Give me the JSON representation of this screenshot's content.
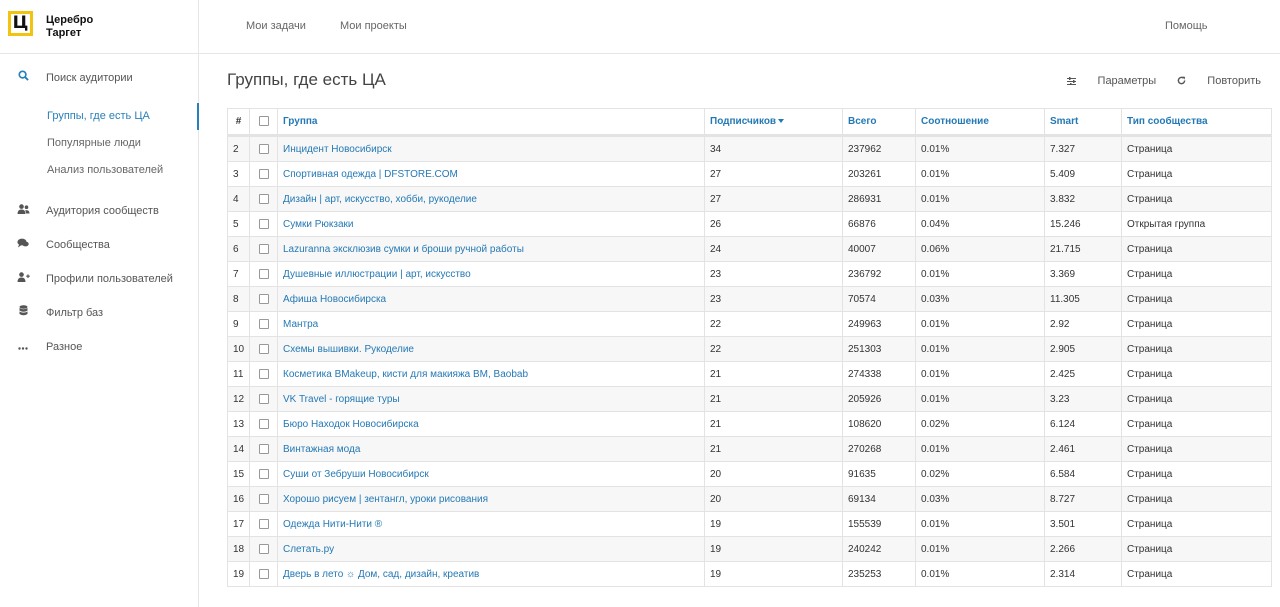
{
  "app": {
    "logo_mark": "Ц",
    "logo_line1": "Церебро",
    "logo_line2": "Таргет"
  },
  "topnav": {
    "tasks": "Мои задачи",
    "projects": "Мои проекты",
    "help": "Помощь"
  },
  "sidebar": {
    "search_audience": "Поиск аудитории",
    "sub": [
      "Группы, где есть ЦА",
      "Популярные люди",
      "Анализ пользователей"
    ],
    "items": [
      "Аудитория сообществ",
      "Сообщества",
      "Профили пользователей",
      "Фильтр баз",
      "Разное"
    ]
  },
  "page": {
    "title": "Группы, где есть ЦА",
    "params": "Параметры",
    "repeat": "Повторить"
  },
  "table": {
    "headers": {
      "num": "#",
      "group": "Группа",
      "subscribers": "Подписчиков",
      "total": "Всего",
      "ratio": "Соотношение",
      "smart": "Smart",
      "type": "Тип сообщества"
    },
    "rows": [
      {
        "n": "2",
        "group": "Инцидент Новосибирск",
        "subs": "34",
        "total": "237962",
        "ratio": "0.01%",
        "smart": "7.327",
        "type": "Страница"
      },
      {
        "n": "3",
        "group": "Спортивная одежда | DFSTORE.COM",
        "subs": "27",
        "total": "203261",
        "ratio": "0.01%",
        "smart": "5.409",
        "type": "Страница"
      },
      {
        "n": "4",
        "group": "Дизайн | арт, искусство, хобби, рукоделие",
        "subs": "27",
        "total": "286931",
        "ratio": "0.01%",
        "smart": "3.832",
        "type": "Страница"
      },
      {
        "n": "5",
        "group": "Сумки Рюкзаки",
        "subs": "26",
        "total": "66876",
        "ratio": "0.04%",
        "smart": "15.246",
        "type": "Открытая группа"
      },
      {
        "n": "6",
        "group": "Lazuranna эксклюзив сумки и броши ручной работы",
        "subs": "24",
        "total": "40007",
        "ratio": "0.06%",
        "smart": "21.715",
        "type": "Страница"
      },
      {
        "n": "7",
        "group": "Душевные иллюстрации | арт, искусство",
        "subs": "23",
        "total": "236792",
        "ratio": "0.01%",
        "smart": "3.369",
        "type": "Страница"
      },
      {
        "n": "8",
        "group": "Афиша Новосибирска",
        "subs": "23",
        "total": "70574",
        "ratio": "0.03%",
        "smart": "11.305",
        "type": "Страница"
      },
      {
        "n": "9",
        "group": "Мантра",
        "subs": "22",
        "total": "249963",
        "ratio": "0.01%",
        "smart": "2.92",
        "type": "Страница"
      },
      {
        "n": "10",
        "group": "Схемы вышивки. Рукоделие",
        "subs": "22",
        "total": "251303",
        "ratio": "0.01%",
        "smart": "2.905",
        "type": "Страница"
      },
      {
        "n": "11",
        "group": "Косметика BMakeup, кисти для макияжа BM, Baobab",
        "subs": "21",
        "total": "274338",
        "ratio": "0.01%",
        "smart": "2.425",
        "type": "Страница"
      },
      {
        "n": "12",
        "group": "VK Travel - горящие туры",
        "subs": "21",
        "total": "205926",
        "ratio": "0.01%",
        "smart": "3.23",
        "type": "Страница"
      },
      {
        "n": "13",
        "group": "Бюро Находок Новосибирска",
        "subs": "21",
        "total": "108620",
        "ratio": "0.02%",
        "smart": "6.124",
        "type": "Страница"
      },
      {
        "n": "14",
        "group": "Винтажная мода",
        "subs": "21",
        "total": "270268",
        "ratio": "0.01%",
        "smart": "2.461",
        "type": "Страница"
      },
      {
        "n": "15",
        "group": "Суши от Зебруши Новосибирск",
        "subs": "20",
        "total": "91635",
        "ratio": "0.02%",
        "smart": "6.584",
        "type": "Страница"
      },
      {
        "n": "16",
        "group": "Хорошо рисуем | зентангл, уроки рисования",
        "subs": "20",
        "total": "69134",
        "ratio": "0.03%",
        "smart": "8.727",
        "type": "Страница"
      },
      {
        "n": "17",
        "group": "Одежда Нити-Нити ®",
        "subs": "19",
        "total": "155539",
        "ratio": "0.01%",
        "smart": "3.501",
        "type": "Страница"
      },
      {
        "n": "18",
        "group": "Слетать.ру",
        "subs": "19",
        "total": "240242",
        "ratio": "0.01%",
        "smart": "2.266",
        "type": "Страница"
      },
      {
        "n": "19",
        "group": "Дверь в лето ☼ Дом, сад, дизайн, креатив",
        "subs": "19",
        "total": "235253",
        "ratio": "0.01%",
        "smart": "2.314",
        "type": "Страница"
      }
    ]
  },
  "colors": {
    "accent": "#2479b5",
    "logo_yellow": "#f1c40f"
  }
}
